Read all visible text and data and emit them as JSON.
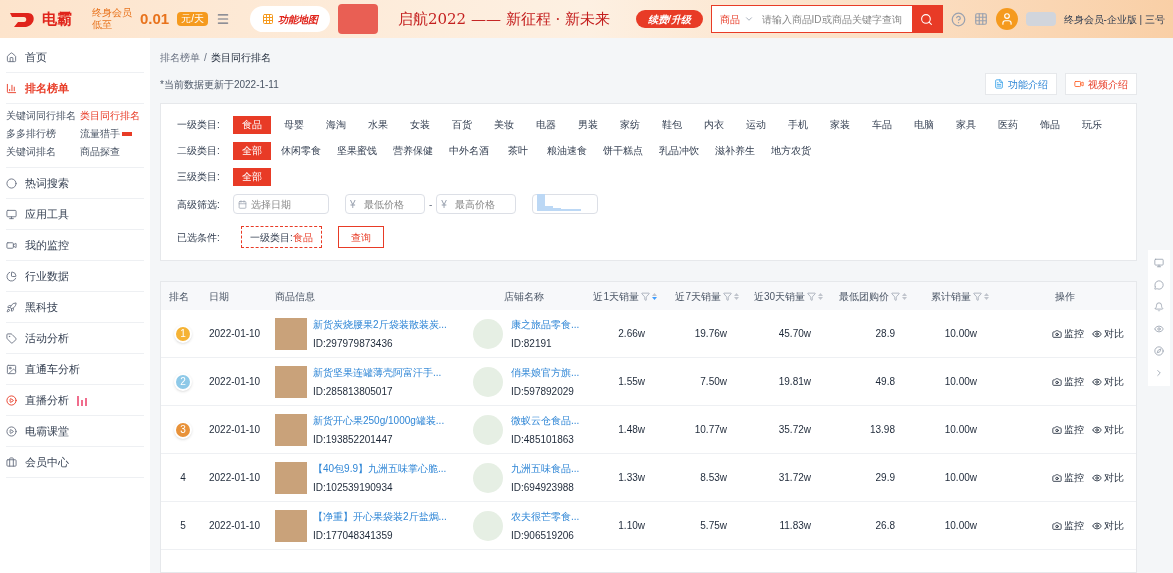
{
  "header": {
    "logo": "电霸",
    "promo_lines": [
      "终身会员",
      "低至"
    ],
    "price": "0.01",
    "price_unit": "元/天",
    "feature_map": "功能地图",
    "slogan": "启航2022 —— 新征程 · 新未来",
    "renew": "续费/升级",
    "search": {
      "scope": "商品",
      "placeholder": "请输入商品ID或商品关键字查询"
    },
    "account": "终身会员-企业版 | 三号"
  },
  "sidebar": {
    "items": [
      {
        "label": "首页",
        "selected": false
      },
      {
        "label": "排名榜单",
        "selected": true,
        "children": [
          {
            "label": "关键词同行排名",
            "selected": false,
            "hot": false
          },
          {
            "label": "类目同行排名",
            "selected": true,
            "hot": false
          },
          {
            "label": "多多排行榜",
            "selected": false,
            "hot": false
          },
          {
            "label": "流量猎手",
            "selected": false,
            "hot": true
          },
          {
            "label": "关键词排名",
            "selected": false,
            "hot": false
          },
          {
            "label": "商品探查",
            "selected": false,
            "hot": false
          }
        ]
      },
      {
        "label": "热词搜索",
        "selected": false
      },
      {
        "label": "应用工具",
        "selected": false
      },
      {
        "label": "我的监控",
        "selected": false
      },
      {
        "label": "行业数据",
        "selected": false
      },
      {
        "label": "黑科技",
        "selected": false
      },
      {
        "label": "活动分析",
        "selected": false
      },
      {
        "label": "直通车分析",
        "selected": false
      },
      {
        "label": "直播分析",
        "selected": false
      },
      {
        "label": "电霸课堂",
        "selected": false
      },
      {
        "label": "会员中心",
        "selected": false
      }
    ]
  },
  "breadcrumb": [
    "排名榜单",
    "/",
    "类目同行排名"
  ],
  "update_note": "*当前数据更新于2022-1-11",
  "help_buttons": [
    {
      "label": "功能介绍",
      "kind": "doc"
    },
    {
      "label": "视频介绍",
      "kind": "video"
    }
  ],
  "filters": [
    {
      "label": "一级类目:",
      "options": [
        {
          "label": "食品",
          "selected": true
        },
        {
          "label": "母婴",
          "selected": false
        },
        {
          "label": "海淘",
          "selected": false
        },
        {
          "label": "水果",
          "selected": false
        },
        {
          "label": "女装",
          "selected": false
        },
        {
          "label": "百货",
          "selected": false
        },
        {
          "label": "美妆",
          "selected": false
        },
        {
          "label": "电器",
          "selected": false
        },
        {
          "label": "男装",
          "selected": false
        },
        {
          "label": "家纺",
          "selected": false
        },
        {
          "label": "鞋包",
          "selected": false
        },
        {
          "label": "内衣",
          "selected": false
        },
        {
          "label": "运动",
          "selected": false
        },
        {
          "label": "手机",
          "selected": false
        },
        {
          "label": "家装",
          "selected": false
        },
        {
          "label": "车品",
          "selected": false
        },
        {
          "label": "电脑",
          "selected": false
        },
        {
          "label": "家具",
          "selected": false
        },
        {
          "label": "医药",
          "selected": false
        },
        {
          "label": "饰品",
          "selected": false
        },
        {
          "label": "玩乐",
          "selected": false
        }
      ]
    },
    {
      "label": "二级类目:",
      "options": [
        {
          "label": "全部",
          "selected": true
        },
        {
          "label": "休闲零食",
          "selected": false
        },
        {
          "label": "坚果蜜饯",
          "selected": false
        },
        {
          "label": "营养保健",
          "selected": false
        },
        {
          "label": "中外名酒",
          "selected": false
        },
        {
          "label": "茶叶",
          "selected": false
        },
        {
          "label": "粮油速食",
          "selected": false
        },
        {
          "label": "饼干糕点",
          "selected": false
        },
        {
          "label": "乳品冲饮",
          "selected": false
        },
        {
          "label": "滋补养生",
          "selected": false
        },
        {
          "label": "地方农货",
          "selected": false
        }
      ]
    },
    {
      "label": "三级类目:",
      "options": [
        {
          "label": "全部",
          "selected": true
        }
      ]
    }
  ],
  "advanced": {
    "label": "高级筛选:",
    "date_placeholder": "选择日期",
    "currency": "¥",
    "min_placeholder": "最低价格",
    "dash": "-",
    "max_placeholder": "最高价格"
  },
  "chosen": {
    "label": "已选条件:",
    "tag_key": "一级类目:",
    "tag_value": "食品",
    "query": "查询"
  },
  "table": {
    "columns": [
      {
        "label": "排名",
        "filter": false
      },
      {
        "label": "日期",
        "filter": false
      },
      {
        "label": "商品信息",
        "filter": false
      },
      {
        "label": "店铺名称",
        "filter": false
      },
      {
        "label": "近1天销量",
        "filter": true,
        "sorted": true
      },
      {
        "label": "近7天销量",
        "filter": true,
        "sorted": false
      },
      {
        "label": "近30天销量",
        "filter": true,
        "sorted": false
      },
      {
        "label": "最低团购价",
        "filter": true,
        "sorted": false
      },
      {
        "label": "累计销量",
        "filter": true,
        "sorted": false
      },
      {
        "label": "操作",
        "filter": false
      }
    ],
    "rows": [
      {
        "rank": "1",
        "kind": "medal",
        "color": "#f5b335",
        "date": "2022-01-10",
        "title": "新货炭烧腰果2斤袋装散装炭...",
        "id": "ID:297979873436",
        "shop": "康之旅品零食...",
        "shop_id": "ID:82191",
        "d1": "2.66w",
        "d7": "19.76w",
        "d30": "45.70w",
        "price": "28.9",
        "total": "10.00w",
        "actions": [
          "监控",
          "对比"
        ]
      },
      {
        "rank": "2",
        "kind": "medal",
        "color": "#8ec9e8",
        "date": "2022-01-10",
        "title": "新货坚果连罐薄壳阿富汗手...",
        "id": "ID:285813805017",
        "shop": "俏果娘官方旗...",
        "shop_id": "ID:597892029",
        "d1": "1.55w",
        "d7": "7.50w",
        "d30": "19.81w",
        "price": "49.8",
        "total": "10.00w",
        "actions": [
          "监控",
          "对比"
        ]
      },
      {
        "rank": "3",
        "kind": "medal",
        "color": "#e8923a",
        "date": "2022-01-10",
        "title": "新货开心果250g/1000g罐装...",
        "id": "ID:193852201447",
        "shop": "微蚁云仓食品...",
        "shop_id": "ID:485101863",
        "d1": "1.48w",
        "d7": "10.77w",
        "d30": "35.72w",
        "price": "13.98",
        "total": "10.00w",
        "actions": [
          "监控",
          "对比"
        ]
      },
      {
        "rank": "4",
        "kind": "plain",
        "date": "2022-01-10",
        "title": "【40包9.9】九洲五味掌心脆...",
        "id": "ID:102539190934",
        "shop": "九洲五味食品...",
        "shop_id": "ID:694923988",
        "d1": "1.33w",
        "d7": "8.53w",
        "d30": "31.72w",
        "price": "29.9",
        "total": "10.00w",
        "actions": [
          "监控",
          "对比"
        ]
      },
      {
        "rank": "5",
        "kind": "plain",
        "date": "2022-01-10",
        "title": "【净重】开心果袋装2斤盐焗...",
        "id": "ID:177048341359",
        "shop": "农夫很芒零食...",
        "shop_id": "ID:906519206",
        "d1": "1.10w",
        "d7": "5.75w",
        "d30": "11.83w",
        "price": "26.8",
        "total": "10.00w",
        "actions": [
          "监控",
          "对比"
        ]
      }
    ]
  }
}
